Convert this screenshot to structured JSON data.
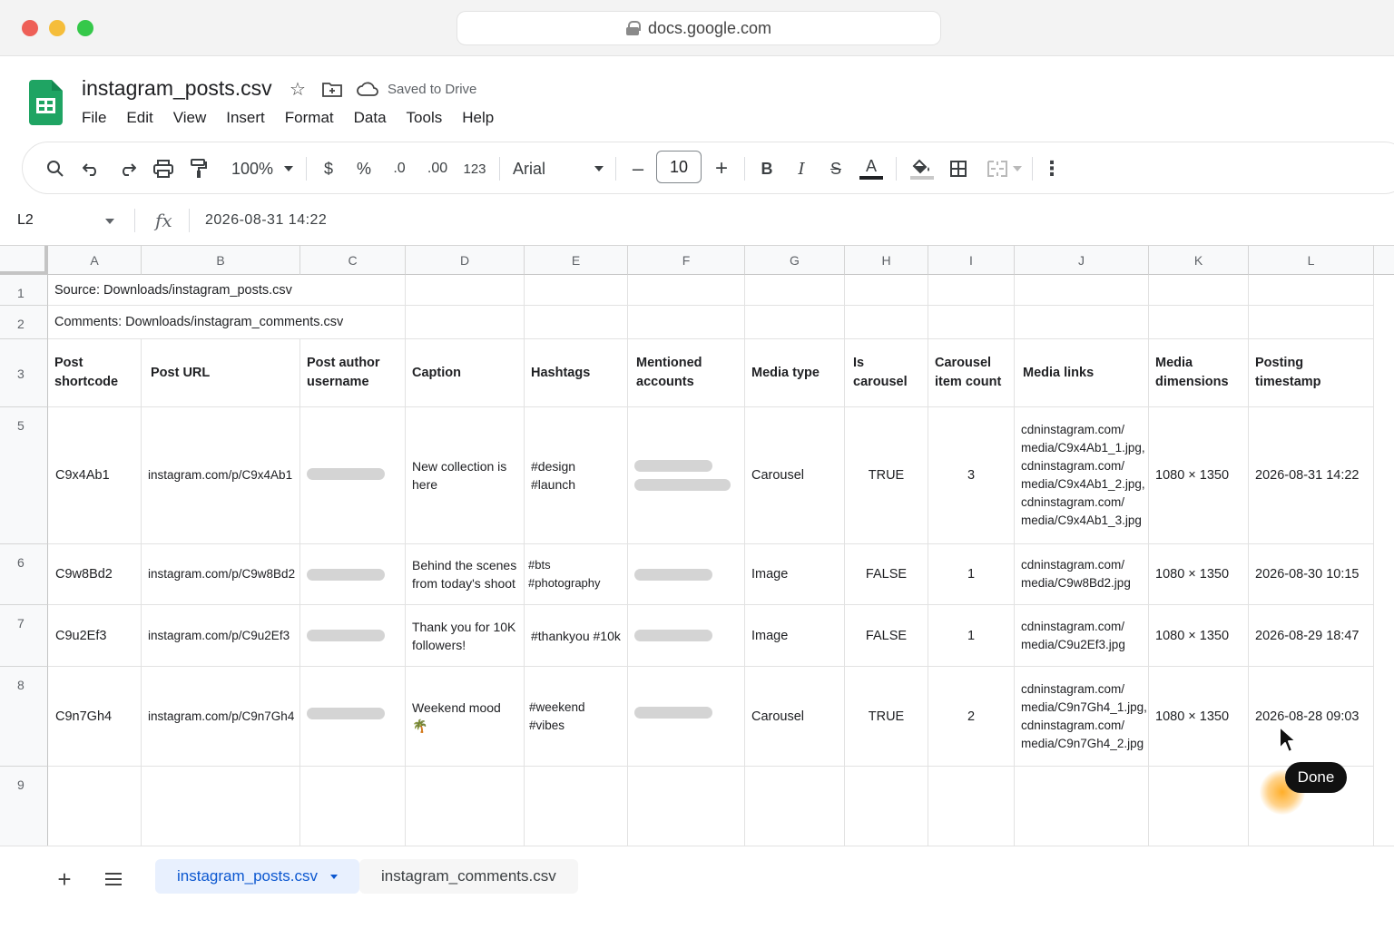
{
  "browser": {
    "url": "docs.google.com"
  },
  "doc": {
    "title": "instagram_posts.csv",
    "saved_status": "Saved to Drive"
  },
  "menu": [
    "File",
    "Edit",
    "View",
    "Insert",
    "Format",
    "Data",
    "Tools",
    "Help"
  ],
  "toolbar": {
    "zoom": "100%",
    "currency": "$",
    "percent": "%",
    "decrease_decimal": ".0",
    "increase_decimal": ".00",
    "number_format": "123",
    "font": "Arial",
    "font_size": "10",
    "minus": "–",
    "plus": "+",
    "bold": "B",
    "italic": "I",
    "strikethrough": "S",
    "text_color": "A",
    "more": "⋮"
  },
  "formula_bar": {
    "cell_ref": "L2",
    "fx": "fx",
    "value": "2026-08-31 14:22"
  },
  "columns": [
    "A",
    "B",
    "C",
    "D",
    "E",
    "F",
    "G",
    "H",
    "I",
    "J",
    "K",
    "L"
  ],
  "row_numbers": [
    "1",
    "2",
    "3",
    "5",
    "6",
    "7",
    "8",
    "9"
  ],
  "row1": "Source: Downloads/instagram_posts.csv",
  "row2": "Comments: Downloads/instagram_comments.csv",
  "headers": [
    "Post shortcode",
    "Post URL",
    "Post author username",
    "Caption",
    "Hashtags",
    "Mentioned accounts",
    "Media type",
    "Is carousel",
    "Carousel item count",
    "Media links",
    "Media dimensions",
    "Posting timestamp"
  ],
  "rows": [
    {
      "shortcode": "C9x4Ab1",
      "url": "instagram.com/p/C9x4Ab1",
      "caption": "New collection is here",
      "hashtags": "#design #launch",
      "media_type": "Carousel",
      "is_carousel": "TRUE",
      "item_count": "3",
      "media_links": "cdninstagram.com/ media/C9x4Ab1_1.jpg, cdninstagram.com/ media/C9x4Ab1_2.jpg, cdninstagram.com/ media/C9x4Ab1_3.jpg",
      "dimensions": "1080 × 1350",
      "timestamp": "2026-08-31 14:22"
    },
    {
      "shortcode": "C9w8Bd2",
      "url": "instagram.com/p/C9w8Bd2",
      "caption": "Behind the scenes from today's shoot",
      "hashtags": "#bts #photography",
      "media_type": "Image",
      "is_carousel": "FALSE",
      "item_count": "1",
      "media_links": "cdninstagram.com/ media/C9w8Bd2.jpg",
      "dimensions": "1080 × 1350",
      "timestamp": "2026-08-30 10:15"
    },
    {
      "shortcode": "C9u2Ef3",
      "url": "instagram.com/p/C9u2Ef3",
      "caption": "Thank you for 10K followers!",
      "hashtags": "#thankyou #10k",
      "media_type": "Image",
      "is_carousel": "FALSE",
      "item_count": "1",
      "media_links": "cdninstagram.com/ media/C9u2Ef3.jpg",
      "dimensions": "1080 × 1350",
      "timestamp": "2026-08-29 18:47"
    },
    {
      "shortcode": "C9n7Gh4",
      "url": "instagram.com/p/C9n7Gh4",
      "caption": "Weekend mood 🌴",
      "hashtags": "#weekend #vibes",
      "media_type": "Carousel",
      "is_carousel": "TRUE",
      "item_count": "2",
      "media_links": "cdninstagram.com/ media/C9n7Gh4_1.jpg, cdninstagram.com/ media/C9n7Gh4_2.jpg",
      "dimensions": "1080 × 1350",
      "timestamp": "2026-08-28 09:03"
    }
  ],
  "sheet_tabs": {
    "active": "instagram_posts.csv",
    "other": "instagram_comments.csv"
  },
  "overlay": {
    "done_label": "Done"
  },
  "colors": {
    "sheets_green": "#1fa463",
    "active_tab_bg": "#e8f0fe",
    "active_tab_text": "#0b57d0",
    "cursor_glow": "#ffaa1e"
  }
}
